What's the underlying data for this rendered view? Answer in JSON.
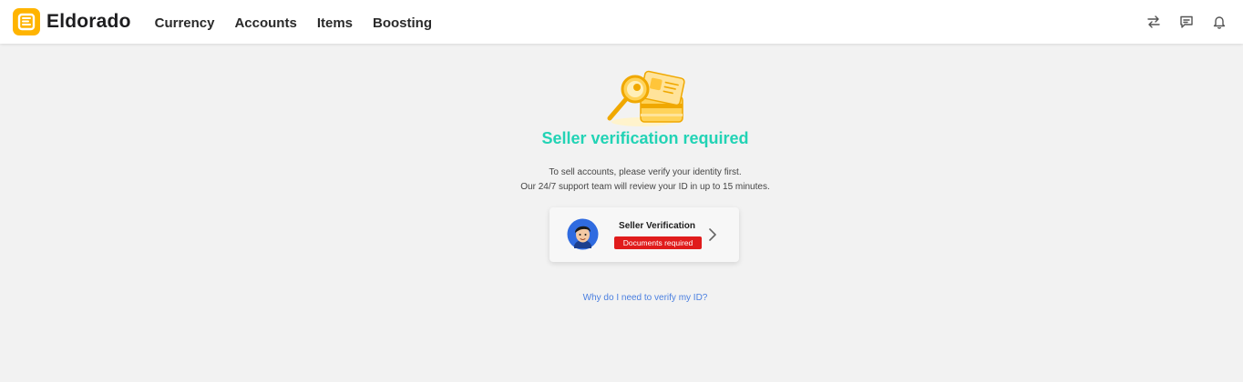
{
  "header": {
    "brand": "Eldorado",
    "nav": [
      "Currency",
      "Accounts",
      "Items",
      "Boosting"
    ],
    "icons": [
      "swap-arrows-icon",
      "chat-icon",
      "bell-icon"
    ]
  },
  "main": {
    "illustration": "id-search-illustration",
    "title": "Seller verification required",
    "description_line1": "To sell accounts, please verify your identity first.",
    "description_line2": "Our 24/7 support team will review your ID in up to 15 minutes.",
    "card": {
      "title": "Seller Verification",
      "badge": "Documents required",
      "avatar": "avatar-icon",
      "chevron": "chevron-right-icon"
    },
    "help_link": "Why do I need to verify my ID?"
  },
  "colors": {
    "brand": "#ffb400",
    "title": "#22d3b5",
    "badge": "#e01b1b",
    "link": "#4a7fe0"
  }
}
